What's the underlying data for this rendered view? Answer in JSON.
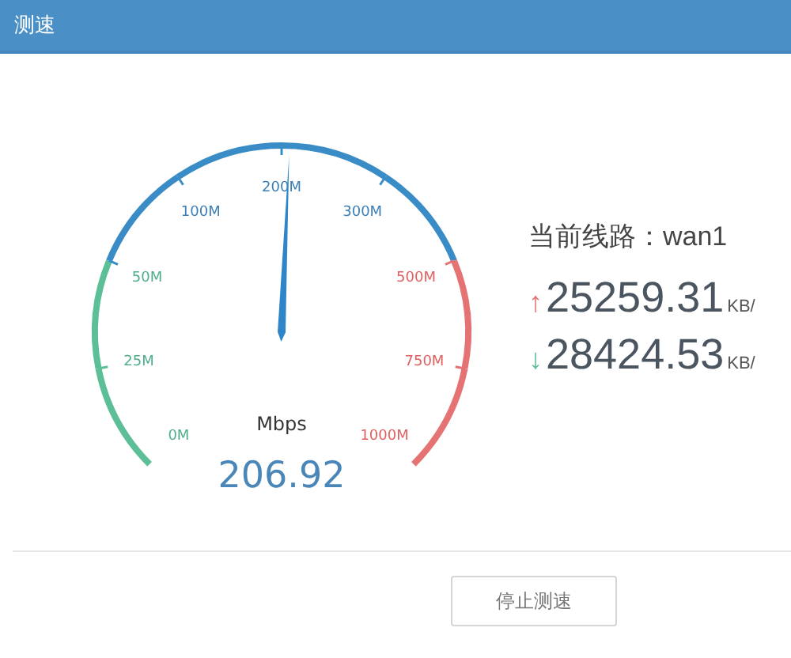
{
  "window": {
    "title": "测速"
  },
  "gauge": {
    "unit": "Mbps",
    "value": "206.92",
    "level": 0.509,
    "scale": [
      {
        "label": "0M",
        "color": "#4fae8a"
      },
      {
        "label": "25M",
        "color": "#4fae8a"
      },
      {
        "label": "50M",
        "color": "#4fae8a"
      },
      {
        "label": "100M",
        "color": "#3a7fb8"
      },
      {
        "label": "200M",
        "color": "#3a7fb8"
      },
      {
        "label": "300M",
        "color": "#3a7fb8"
      },
      {
        "label": "500M",
        "color": "#e06060"
      },
      {
        "label": "750M",
        "color": "#e06060"
      },
      {
        "label": "1000M",
        "color": "#e06060"
      }
    ],
    "arc": [
      {
        "color": "#5dbf97"
      },
      {
        "color": "#5dbf97"
      },
      {
        "color": "#3a8cc6"
      },
      {
        "color": "#3a8cc6"
      },
      {
        "color": "#3a8cc6"
      },
      {
        "color": "#3a8cc6"
      },
      {
        "color": "#e57373"
      },
      {
        "color": "#e57373"
      }
    ]
  },
  "line": {
    "label": "当前线路：wan1"
  },
  "speeds": [
    {
      "kind": "up",
      "arrow": "↑",
      "value": "25259.31",
      "unit": "KB/"
    },
    {
      "kind": "down",
      "arrow": "↓",
      "value": "28424.53",
      "unit": "KB/"
    }
  ],
  "buttons": [
    {
      "label": "停止测速"
    }
  ]
}
